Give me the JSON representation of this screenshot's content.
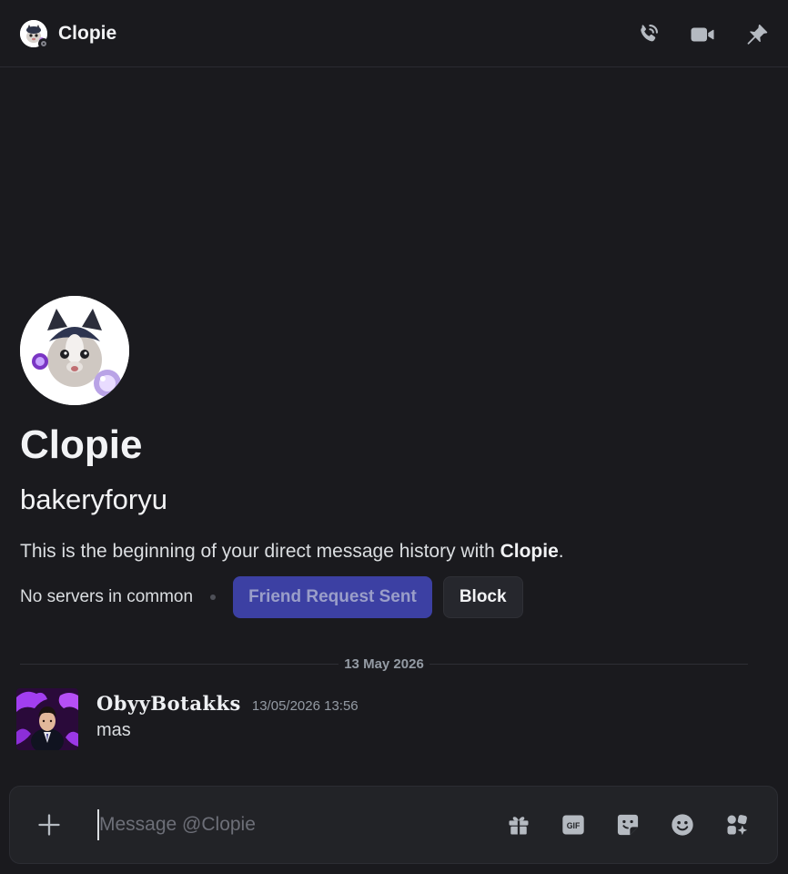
{
  "header": {
    "title": "Clopie",
    "status": "offline"
  },
  "welcome": {
    "display_name": "Clopie",
    "username": "bakeryforyu",
    "description_prefix": "This is the beginning of your direct message history with ",
    "description_name": "Clopie",
    "description_suffix": ".",
    "mutual_servers": "No servers in common",
    "friend_button": "Friend Request Sent",
    "block_button": "Block"
  },
  "divider": {
    "date": "13 May 2026"
  },
  "messages": [
    {
      "author": "𝐎𝐛𝐲𝐲𝐁𝐨𝐭𝐚𝐤𝐤𝐬",
      "timestamp": "13/05/2026 13:56",
      "text": "mas"
    }
  ],
  "composer": {
    "placeholder": "Message @Clopie"
  },
  "icons": {
    "header": [
      "phone-call-icon",
      "video-camera-icon",
      "pin-icon"
    ],
    "composer": [
      "plus-icon",
      "gift-icon",
      "gif-icon",
      "sticker-icon",
      "emoji-icon",
      "apps-icon"
    ]
  },
  "colors": {
    "background": "#1a1a1e",
    "composer_bg": "#222327",
    "friend_button_bg": "#3c40a3",
    "friend_button_text": "#9a9ec9",
    "block_button_bg": "#26272d",
    "muted_text": "#949ba4",
    "icon": "#b5bac1"
  }
}
